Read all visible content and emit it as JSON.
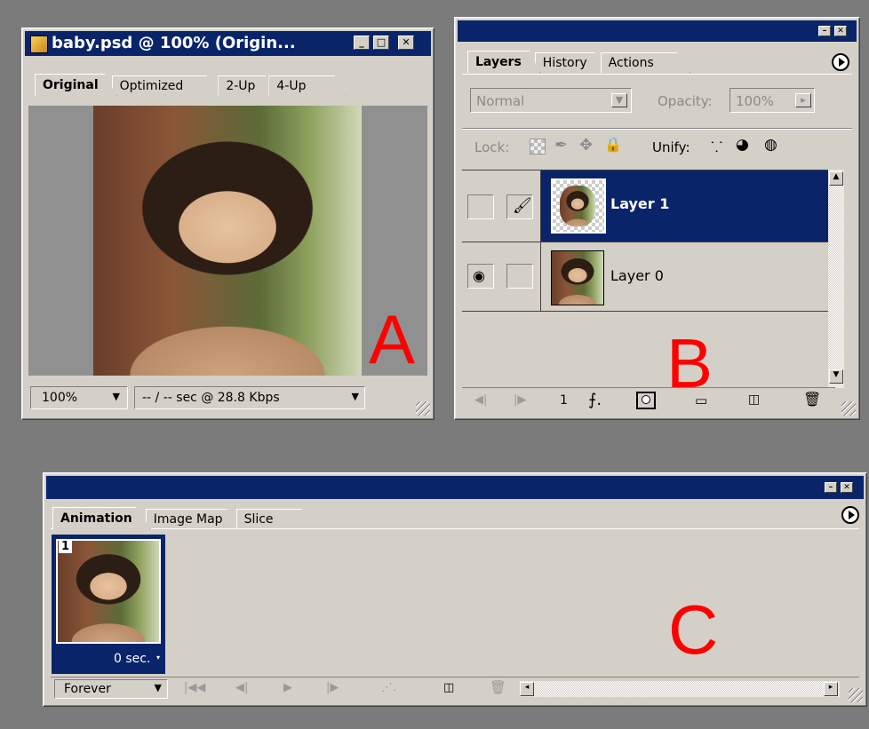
{
  "colors": {
    "title_active": "#0a246a",
    "panel_bg": "#d4d0c8",
    "selection": "#0a246a",
    "label_red": "#ff0000",
    "desktop": "#7b7b7b"
  },
  "doc_window": {
    "title": "baby.psd @ 100% (Origin...",
    "tabs": [
      "Original",
      "Optimized",
      "2-Up",
      "4-Up"
    ],
    "zoom": "100%",
    "speed": "-- / -- sec @ 28.8 Kbps"
  },
  "layers_panel": {
    "tabs": [
      "Layers",
      "History",
      "Actions"
    ],
    "blend_mode": "Normal",
    "opacity_label": "Opacity:",
    "opacity_value": "100%",
    "lock_label": "Lock:",
    "unify_label": "Unify:",
    "layers": [
      {
        "name": "Layer 1",
        "selected": true
      },
      {
        "name": "Layer 0",
        "selected": false
      }
    ],
    "frame_number": "1"
  },
  "animation_panel": {
    "tabs": [
      "Animation",
      "Image Map",
      "Slice"
    ],
    "frame_number": "1",
    "frame_delay": "0 sec.",
    "loop": "Forever"
  },
  "labels": {
    "a": "A",
    "b": "B",
    "c": "C"
  }
}
